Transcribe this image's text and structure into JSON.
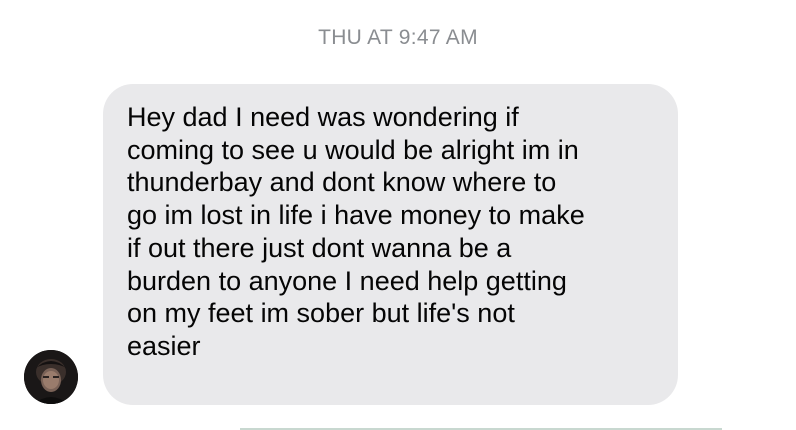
{
  "conversation": {
    "timestamp": "THU AT 9:47 AM",
    "messages": [
      {
        "sender": "received",
        "avatar_icon": "contact-avatar-photo",
        "text": "Hey dad I need was wondering if\ncoming to see u would be alright im in\nthunderbay and dont know where to\ngo im lost in life i have money to make\nif out there just dont wanna be a\nburden to anyone I need help getting\non my feet im sober but life's not\neasier"
      }
    ]
  },
  "colors": {
    "bubble_background": "#e9e9eb",
    "message_text": "#050505",
    "timestamp_text": "#8a8d91",
    "page_background": "#ffffff"
  }
}
